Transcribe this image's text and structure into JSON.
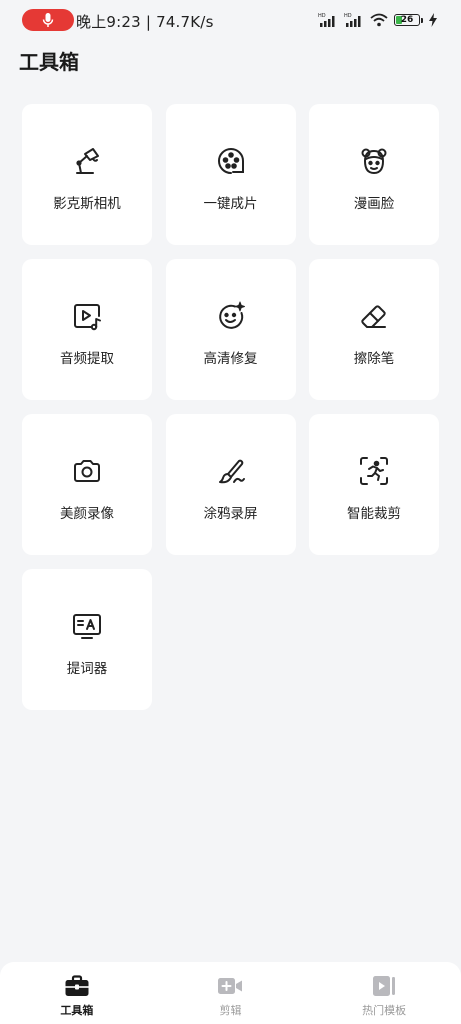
{
  "status_bar": {
    "time_speed": "晚上9:23 | 74.7K/s",
    "signal1_label": "HD",
    "signal2_label": "HD",
    "battery_level": "26",
    "record_color": "#e53935"
  },
  "page": {
    "title": "工具箱"
  },
  "tools": [
    {
      "label": "影克斯相机",
      "icon": "desk-lamp-icon"
    },
    {
      "label": "一键成片",
      "icon": "film-reel-icon"
    },
    {
      "label": "漫画脸",
      "icon": "cartoon-face-icon"
    },
    {
      "label": "音频提取",
      "icon": "audio-extract-icon"
    },
    {
      "label": "高清修复",
      "icon": "sparkle-face-icon"
    },
    {
      "label": "擦除笔",
      "icon": "eraser-icon"
    },
    {
      "label": "美颜录像",
      "icon": "camera-icon"
    },
    {
      "label": "涂鸦录屏",
      "icon": "paintbrush-icon"
    },
    {
      "label": "智能裁剪",
      "icon": "running-figure-scan-icon"
    },
    {
      "label": "提词器",
      "icon": "teleprompter-icon"
    }
  ],
  "bottom_nav": {
    "items": [
      {
        "label": "工具箱",
        "icon": "toolbox-icon",
        "active": true
      },
      {
        "label": "剪辑",
        "icon": "video-add-icon",
        "active": false
      },
      {
        "label": "热门模板",
        "icon": "template-icon",
        "active": false
      }
    ]
  }
}
